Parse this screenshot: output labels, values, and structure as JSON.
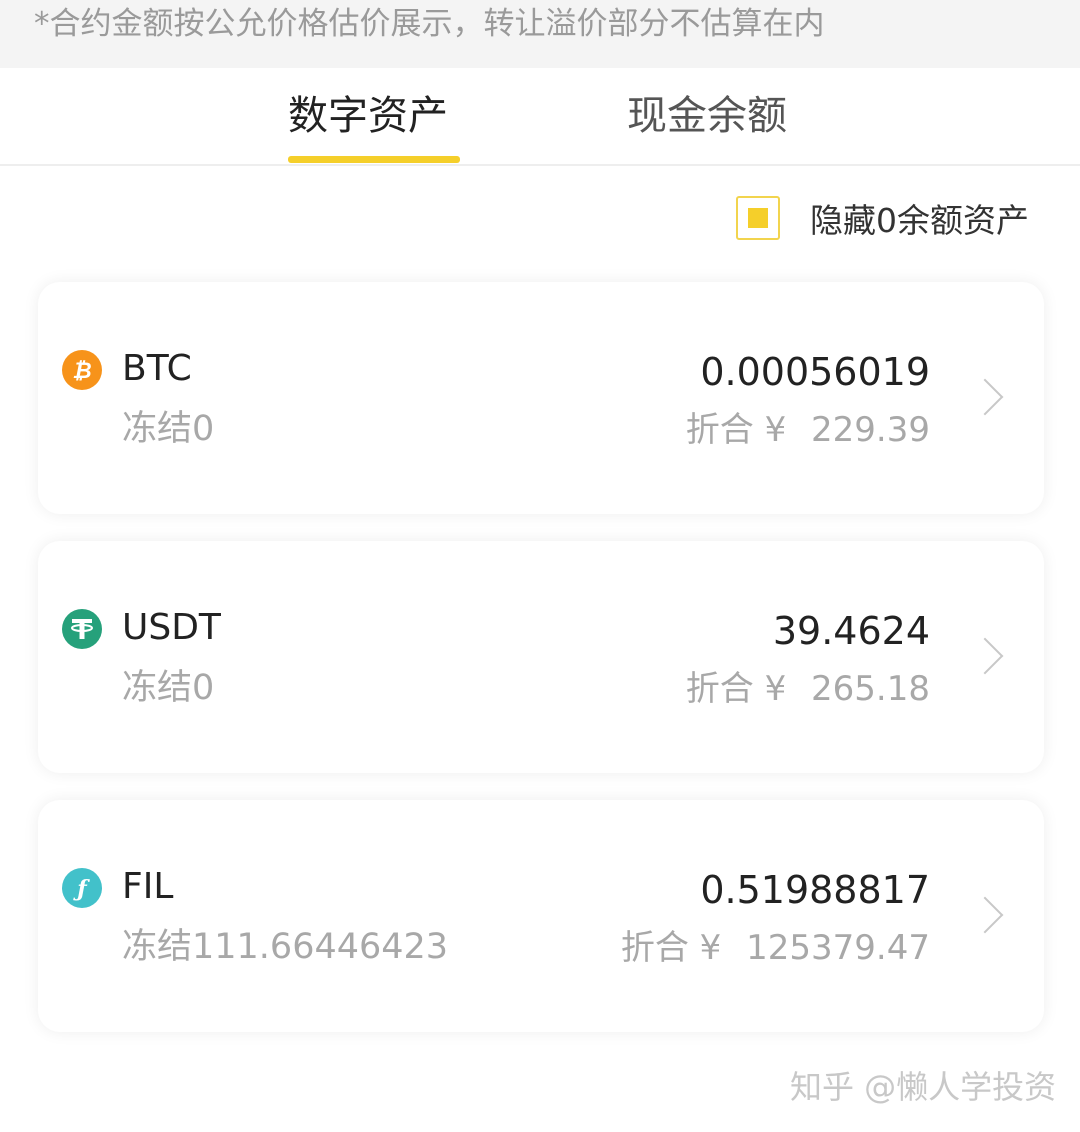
{
  "notice": "*合约金额按公允价格估价展示，转让溢价部分不估算在内",
  "tabs": {
    "digital_assets": "数字资产",
    "cash_balance": "现金余额"
  },
  "hide_zero": {
    "label": "隐藏0余额资产",
    "checked": true
  },
  "assets": [
    {
      "name": "BTC",
      "frozen": "冻结0",
      "amount": "0.00056019",
      "approx_label": "折合",
      "currency_symbol": "¥",
      "approx_value": "229.39",
      "icon": "bitcoin-icon",
      "icon_color": "#f7931a"
    },
    {
      "name": "USDT",
      "frozen": "冻结0",
      "amount": "39.4624",
      "approx_label": "折合",
      "currency_symbol": "¥",
      "approx_value": "265.18",
      "icon": "tether-icon",
      "icon_color": "#26a17b"
    },
    {
      "name": "FIL",
      "frozen": "冻结111.66446423",
      "amount": "0.51988817",
      "approx_label": "折合",
      "currency_symbol": "¥",
      "approx_value": "125379.47",
      "icon": "filecoin-icon",
      "icon_color": "#42c1ca"
    }
  ],
  "watermark": "知乎 @懒人学投资",
  "colors": {
    "accent": "#f5cf2a",
    "muted_text": "#a8a8a8"
  }
}
